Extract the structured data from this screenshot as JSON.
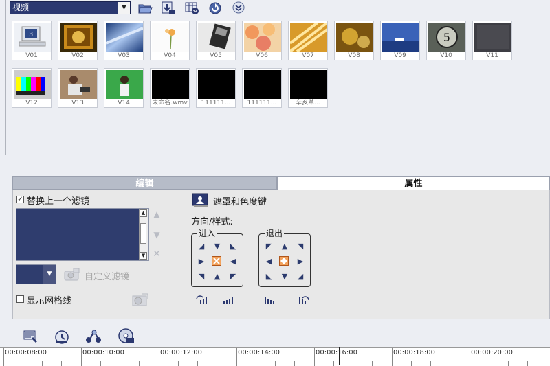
{
  "toolbar": {
    "library_select": "视频",
    "icons": [
      "folder-open-icon",
      "import-icon",
      "view-options-icon",
      "refresh-icon",
      "expand-icon"
    ]
  },
  "thumbnails": [
    {
      "label": "V01",
      "style": "monitor"
    },
    {
      "label": "V02",
      "style": "filmstrip"
    },
    {
      "label": "V03",
      "style": "blue-metal"
    },
    {
      "label": "V04",
      "style": "flower"
    },
    {
      "label": "V05",
      "style": "filmroll"
    },
    {
      "label": "V06",
      "style": "bokeh"
    },
    {
      "label": "V07",
      "style": "light-streaks"
    },
    {
      "label": "V08",
      "style": "gold-blur"
    },
    {
      "label": "V09",
      "style": "sea"
    },
    {
      "label": "V10",
      "style": "countdown"
    },
    {
      "label": "V11",
      "style": "noise"
    },
    {
      "label": "V12",
      "style": "test-card"
    },
    {
      "label": "V13",
      "style": "person-sofa"
    },
    {
      "label": "V14",
      "style": "green-screen"
    },
    {
      "label": "未命名.wmv",
      "style": "black"
    },
    {
      "label": "111111...",
      "style": "black"
    },
    {
      "label": "111111...",
      "style": "black"
    },
    {
      "label": "辛亥革...",
      "style": "black"
    }
  ],
  "tabs": {
    "edit": "编辑",
    "attributes": "属性"
  },
  "panel": {
    "replace_filter_label": "替换上一个滤镜",
    "replace_filter_checked": true,
    "custom_filter_label": "自定义滤镜",
    "show_grid_label": "显示网格线",
    "show_grid_checked": false,
    "mask_chroma_label": "遮罩和色度键",
    "direction_style_label": "方向/样式:",
    "enter_label": "进入",
    "exit_label": "退出"
  },
  "timeline": {
    "ticks": [
      "00:00:08:00",
      "00:00:10:00",
      "00:00:12:00",
      "00:00:14:00",
      "00:00:16:00",
      "00:00:18:00",
      "00:00:20:00"
    ]
  },
  "colors": {
    "accent": "#2b3870",
    "list_bg": "#2f3d6e",
    "highlight": "#f2a25c"
  }
}
